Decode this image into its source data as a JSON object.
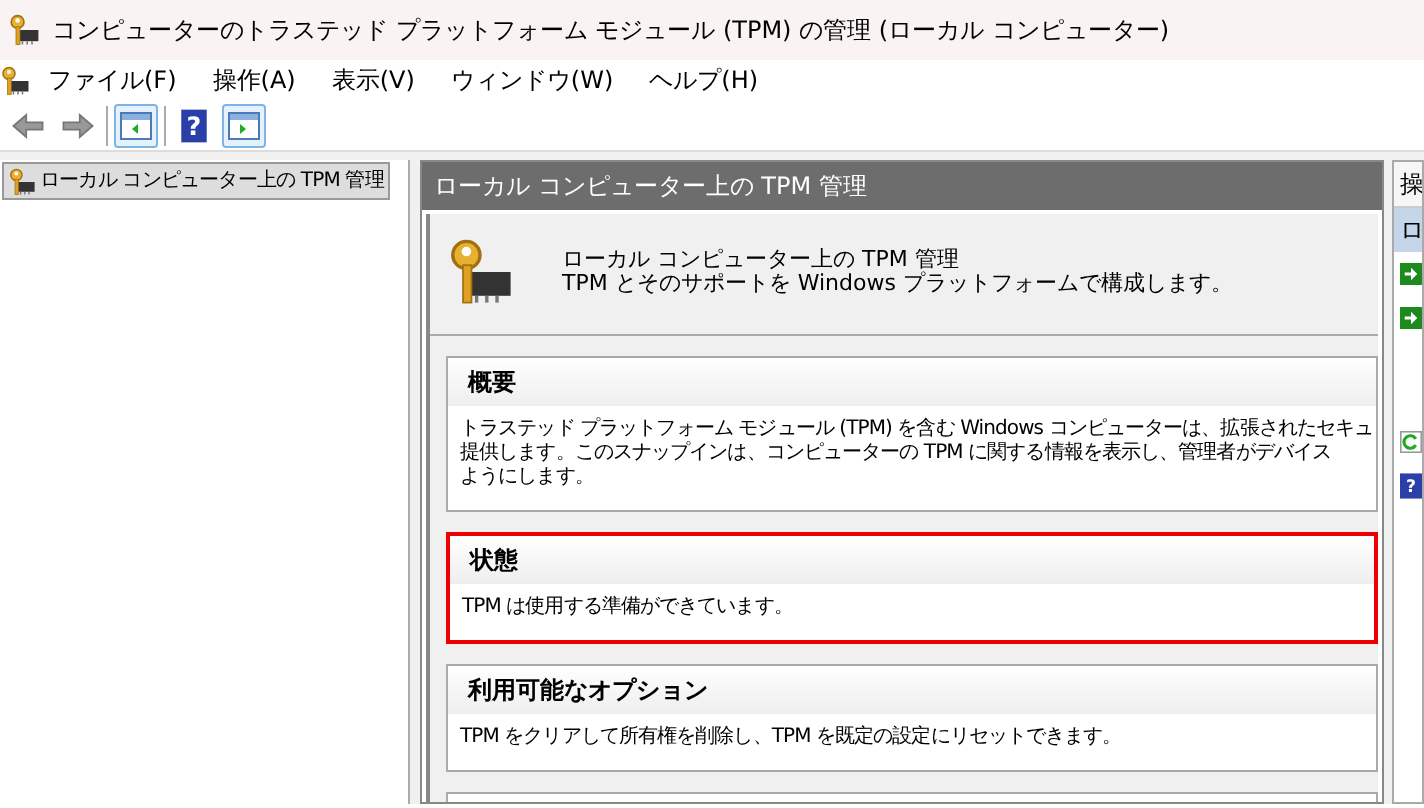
{
  "window": {
    "title": "コンピューターのトラステッド プラットフォーム モジュール (TPM) の管理 (ローカル コンピューター)"
  },
  "toolbar": {
    "help_glyph": "?"
  },
  "menu": [
    {
      "label": "ファイル(F)"
    },
    {
      "label": "操作(A)"
    },
    {
      "label": "表示(V)"
    },
    {
      "label": "ウィンドウ(W)"
    },
    {
      "label": "ヘルプ(H)"
    }
  ],
  "tree": {
    "items": [
      {
        "label": "ローカル コンピューター上の TPM 管理",
        "selected": true
      }
    ]
  },
  "main": {
    "header": "ローカル コンピューター上の TPM 管理",
    "intro": {
      "title": "ローカル コンピューター上の TPM 管理",
      "subtitle": "TPM とそのサポートを Windows プラットフォームで構成します。"
    },
    "sections": [
      {
        "heading": "概要",
        "lines": [
          "トラステッド プラットフォーム モジュール (TPM) を含む Windows コンピューターは、拡張されたセキュ",
          "提供します。このスナップインは、コンピューターの TPM に関する情報を表示し、管理者がデバイス",
          "ようにします。"
        ],
        "highlighted": false
      },
      {
        "heading": "状態",
        "lines": [
          "TPM は使用する準備ができています。"
        ],
        "highlighted": true
      },
      {
        "heading": "利用可能なオプション",
        "lines": [
          "TPM をクリアして所有権を削除し、TPM を既定の設定にリセットできます。"
        ],
        "highlighted": false
      }
    ]
  },
  "actions": {
    "header": "操",
    "items": [
      {
        "kind": "group",
        "label": "ロ",
        "selected": true
      },
      {
        "kind": "action-arrow"
      },
      {
        "kind": "action-arrow"
      },
      {
        "kind": "gap"
      },
      {
        "kind": "refresh"
      },
      {
        "kind": "help",
        "glyph": "?"
      }
    ]
  }
}
